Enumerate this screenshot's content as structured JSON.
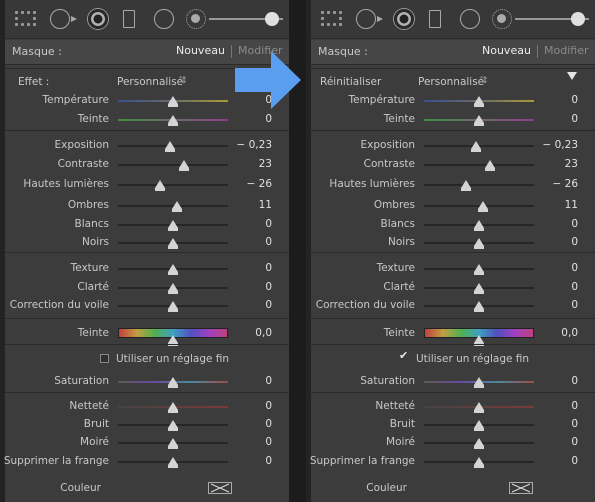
{
  "icons": [
    "grid-icon",
    "brush-pin-icon",
    "radial-filter-icon",
    "graduated-filter-icon",
    "spot-removal-icon",
    "sun-exposure-icon"
  ],
  "mask": {
    "label": "Masque :",
    "new": "Nouveau",
    "modify": "Modifier"
  },
  "left": {
    "effect_label": "Effet :",
    "effect_value": "Personnalisé",
    "caret": "⇕",
    "rows": [
      {
        "label": "Température",
        "value": "0"
      },
      {
        "label": "Teinte",
        "value": "0"
      },
      {
        "label": "Exposition",
        "value": "− 0,23"
      },
      {
        "label": "Contraste",
        "value": "23"
      },
      {
        "label": "Hautes lumières",
        "value": "− 26"
      },
      {
        "label": "Ombres",
        "value": "11"
      },
      {
        "label": "Blancs",
        "value": "0"
      },
      {
        "label": "Noirs",
        "value": "0"
      },
      {
        "label": "Texture",
        "value": "0"
      },
      {
        "label": "Clarté",
        "value": "0"
      },
      {
        "label": "Correction du voile",
        "value": "0"
      },
      {
        "label": "Teinte",
        "value": "0,0"
      },
      {
        "label": "Saturation",
        "value": "0"
      },
      {
        "label": "Netteté",
        "value": "0"
      },
      {
        "label": "Bruit",
        "value": "0"
      },
      {
        "label": "Moiré",
        "value": "0"
      },
      {
        "label": "Supprimer la frange",
        "value": "0"
      }
    ],
    "fine_label": "Utiliser un réglage fin",
    "color_label": "Couleur"
  },
  "right": {
    "effect_label": "Réinitialiser",
    "effect_value": "Personnalisé",
    "caret": "⇕",
    "rows": [
      {
        "label": "Température",
        "value": "0"
      },
      {
        "label": "Teinte",
        "value": "0"
      },
      {
        "label": "Exposition",
        "value": "− 0,23"
      },
      {
        "label": "Contraste",
        "value": "23"
      },
      {
        "label": "Hautes lumières",
        "value": "− 26"
      },
      {
        "label": "Ombres",
        "value": "11"
      },
      {
        "label": "Blancs",
        "value": "0"
      },
      {
        "label": "Noirs",
        "value": "0"
      },
      {
        "label": "Texture",
        "value": "0"
      },
      {
        "label": "Clarté",
        "value": "0"
      },
      {
        "label": "Correction du voile",
        "value": "0"
      },
      {
        "label": "Teinte",
        "value": "0,0"
      },
      {
        "label": "Saturation",
        "value": "0"
      },
      {
        "label": "Netteté",
        "value": "0"
      },
      {
        "label": "Bruit",
        "value": "0"
      },
      {
        "label": "Moiré",
        "value": "0"
      },
      {
        "label": "Supprimer la frange",
        "value": "0"
      }
    ],
    "fine_label": "Utiliser un réglage fin",
    "check_mark": "✔",
    "color_label": "Couleur"
  },
  "arrow_color": "#5b9ef0"
}
